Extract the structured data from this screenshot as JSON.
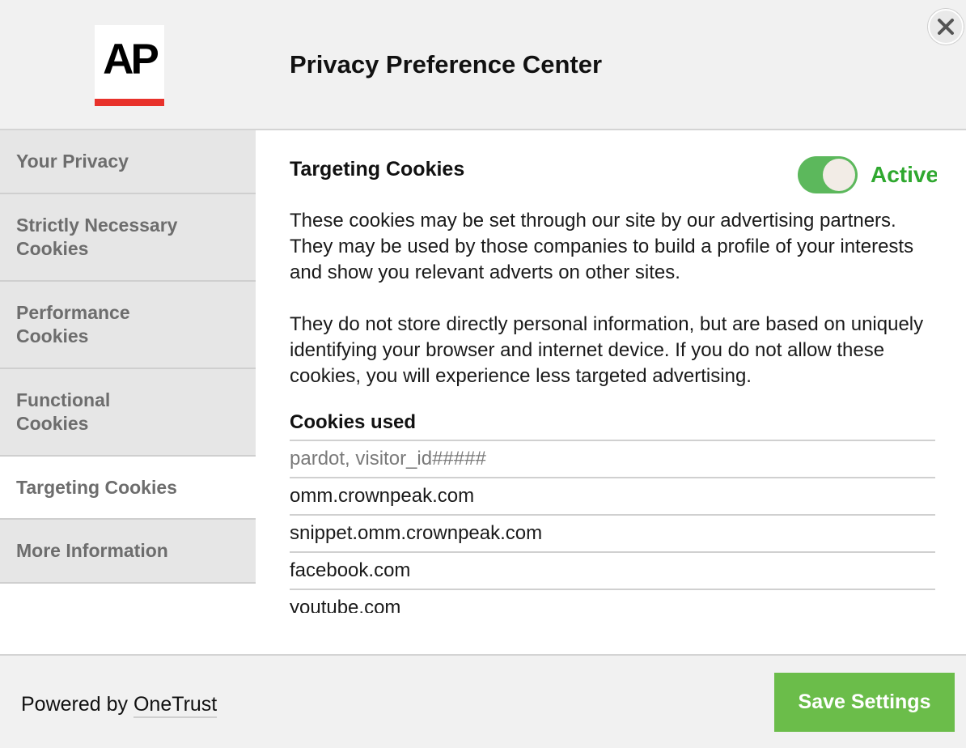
{
  "header": {
    "logo_text": "AP",
    "title": "Privacy Preference Center"
  },
  "sidebar": {
    "items": [
      {
        "label": "Your Privacy"
      },
      {
        "label": "Strictly Necessary Cookies"
      },
      {
        "label": "Performance Cookies"
      },
      {
        "label": "Functional Cookies"
      },
      {
        "label": "Targeting Cookies",
        "active": true
      },
      {
        "label": "More Information"
      }
    ]
  },
  "content": {
    "section_title": "Targeting Cookies",
    "toggle": {
      "state": "on",
      "status_label": "Active",
      "color": "#5cb85c"
    },
    "paragraphs": [
      "These cookies may be set through our site by our advertising partners. They may be used by those companies to build a profile of your interests and show you relevant adverts on other sites.",
      "They do not store directly personal information, but are based on uniquely identifying your browser and internet device. If you do not allow these cookies, you will experience less targeted advertising."
    ],
    "cookies_heading": "Cookies used",
    "cookies": [
      "pardot, visitor_id#####",
      "omm.crownpeak.com",
      "snippet.omm.crownpeak.com",
      "facebook.com",
      "youtube.com"
    ]
  },
  "footer": {
    "powered_by": "Powered by",
    "powered_link": "OneTrust",
    "save_label": "Save Settings"
  },
  "colors": {
    "accent_green": "#6bbd4a",
    "status_green": "#2fa82f",
    "logo_red": "#e8322b"
  }
}
